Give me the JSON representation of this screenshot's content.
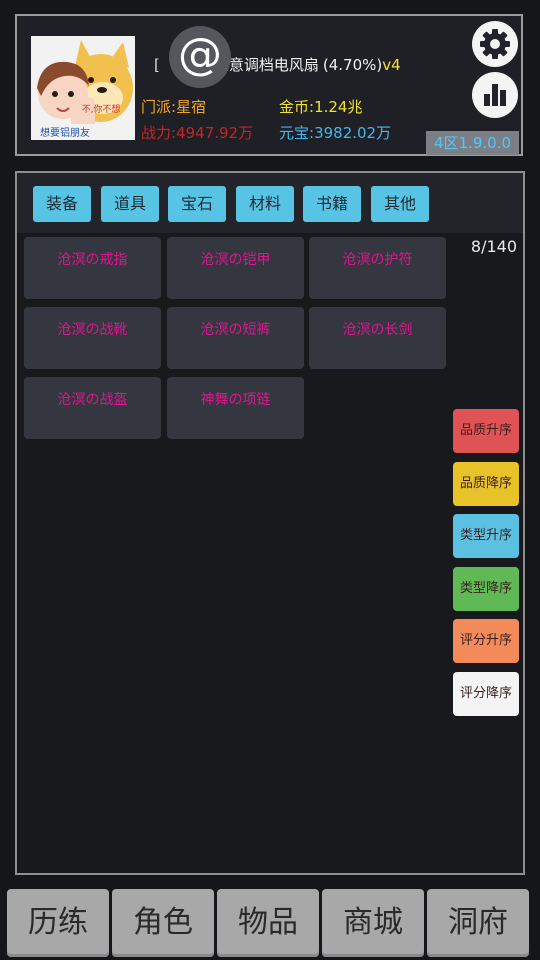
{
  "header": {
    "at_icon": "at-sign-icon",
    "title_bracket": "[",
    "title_name": "任意调档电风扇",
    "title_pct": "(4.70%)",
    "title_ver": "v4",
    "sect_label": "门派:",
    "sect_value": "星宿",
    "power_label": "战力:",
    "power_value": "4947.92万",
    "gold_label": "金币:",
    "gold_value": "1.24兆",
    "yuanbao_label": "元宝:",
    "yuanbao_value": "3982.02万",
    "version": "4区1.9.0.0",
    "avatar_speech": "不,你不想",
    "avatar_caption": "想要铝朋友",
    "settings_icon": "gear-icon",
    "stats_icon": "bar-chart-icon"
  },
  "tabs": [
    "装备",
    "道具",
    "宝石",
    "材料",
    "书籍",
    "其他"
  ],
  "inventory": {
    "count": "8/140",
    "items": [
      "沧溟の戒指",
      "沧溟の铠甲",
      "沧溟の护符",
      "沧溟の战靴",
      "沧溟の短裤",
      "沧溟の长剑",
      "沧溟の战盔",
      "神舞の项链"
    ]
  },
  "sort_buttons": [
    {
      "label": "品质升序",
      "color": "#e05355"
    },
    {
      "label": "品质降序",
      "color": "#e8c229"
    },
    {
      "label": "类型升序",
      "color": "#5ac1e3"
    },
    {
      "label": "类型降序",
      "color": "#5fba55"
    },
    {
      "label": "评分升序",
      "color": "#f38a5a"
    },
    {
      "label": "评分降序",
      "color": "#f4f4f4"
    }
  ],
  "bottom_nav": [
    "历练",
    "角色",
    "物品",
    "商城",
    "洞府"
  ],
  "colors": {
    "accent_tab": "#58c4e5",
    "item_text": "#e0148e",
    "gold": "#f4e12a",
    "sect": "#f4a423",
    "power": "#c92424",
    "yuanbao": "#45b7ee"
  }
}
